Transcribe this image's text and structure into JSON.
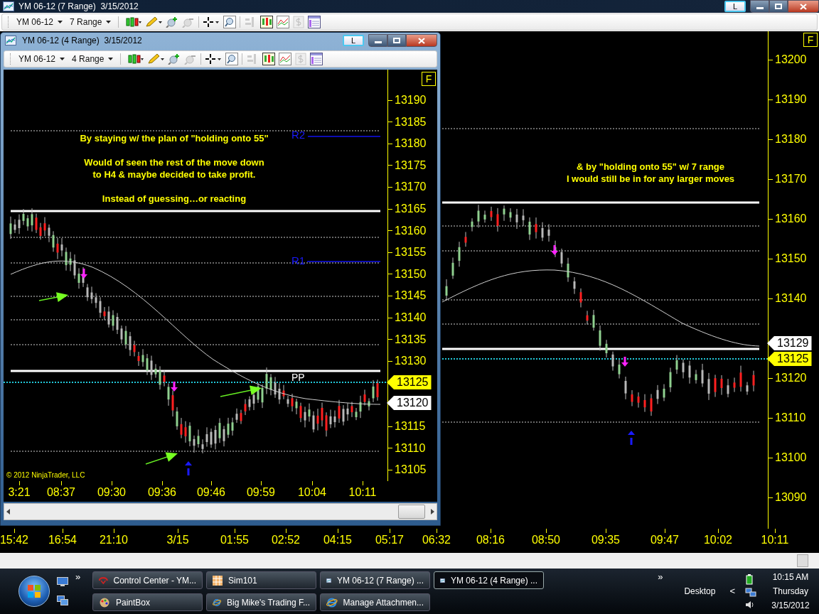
{
  "outer_window": {
    "title": "YM 06-12 (7 Range)  3/15/2012",
    "l_button": "L",
    "toolbar": {
      "instrument": "YM 06-12",
      "period": "7 Range"
    },
    "chart": {
      "f_button": "F",
      "price_labels": [
        "13200",
        "13190",
        "13180",
        "13170",
        "13160",
        "13150",
        "13140",
        "13120",
        "13110",
        "13100",
        "13090"
      ],
      "price_flags": [
        {
          "text": "13129",
          "kind": "marker"
        },
        {
          "text": "13125",
          "kind": "last"
        }
      ],
      "annotation": [
        "& by \"holding onto 55\" w/ 7 range",
        "I would still be in for any larger moves"
      ],
      "time_labels": [
        "15:42",
        "16:54",
        "21:10",
        "3/15",
        "01:55",
        "02:52",
        "04:15",
        "05:17",
        "06:32",
        "08:16",
        "08:50",
        "09:35",
        "09:47",
        "10:02",
        "10:11"
      ]
    }
  },
  "inner_window": {
    "title": "YM 06-12 (4 Range)  3/15/2012",
    "l_button": "L",
    "toolbar": {
      "instrument": "YM 06-12",
      "period": "4 Range"
    },
    "chart": {
      "f_button": "F",
      "price_labels": [
        "13190",
        "13185",
        "13180",
        "13175",
        "13170",
        "13165",
        "13160",
        "13155",
        "13150",
        "13145",
        "13140",
        "13135",
        "13130",
        "13115",
        "13110",
        "13105"
      ],
      "price_flags": [
        {
          "text": "13125",
          "kind": "last"
        },
        {
          "text": "13120",
          "kind": "marker"
        }
      ],
      "pivot_labels": [
        "R2",
        "R1",
        "PP"
      ],
      "annotation": [
        "By staying w/ the plan of \"holding onto 55\"",
        "Would of seen the rest of the move down",
        "to H4 & maybe decided to take profit.",
        "Instead of guessing…or reacting"
      ],
      "copyright": "© 2012 NinjaTrader, LLC",
      "time_labels": [
        "3:21",
        "08:37",
        "09:30",
        "09:36",
        "09:46",
        "09:59",
        "10:04",
        "10:11"
      ]
    }
  },
  "taskbar": {
    "buttons": [
      {
        "label": "Control Center - YM...",
        "selected": false
      },
      {
        "label": "Sim101",
        "selected": false
      },
      {
        "label": "YM 06-12 (7 Range) ...",
        "selected": false
      },
      {
        "label": "YM 06-12 (4 Range) ...",
        "selected": true
      },
      {
        "label": "PaintBox",
        "selected": false
      },
      {
        "label": "Big Mike's Trading F...",
        "selected": false
      },
      {
        "label": "Manage Attachmen...",
        "selected": false
      }
    ],
    "overflow": "»",
    "tray_overflow": "»",
    "desktop": "Desktop",
    "tray_arrow": "<",
    "clock": {
      "time": "10:15 AM",
      "day": "Thursday",
      "date": "3/15/2012"
    }
  }
}
